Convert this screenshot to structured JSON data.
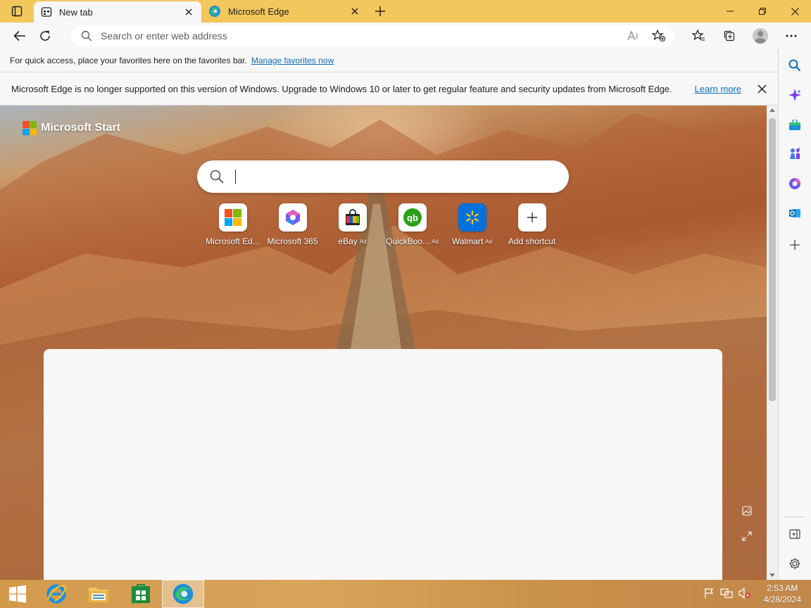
{
  "tabs": [
    {
      "title": "New tab",
      "active": true,
      "icon": "newtab-page-icon"
    },
    {
      "title": "Microsoft Edge",
      "active": false,
      "icon": "edge-logo-icon"
    }
  ],
  "toolbar": {
    "address_placeholder": "Search or enter web address"
  },
  "favorites_bar": {
    "message": "For quick access, place your favorites here on the favorites bar.",
    "link": "Manage favorites now"
  },
  "infobar": {
    "message": "Microsoft Edge is no longer supported on this version of Windows. Upgrade to Windows 10 or later to get regular feature and security updates from Microsoft Edge.",
    "link": "Learn more"
  },
  "newtab": {
    "brand": "Microsoft Start",
    "shortcuts": [
      {
        "label": "Microsoft Ed...",
        "ad": "",
        "icon": "microsoft-logo-icon"
      },
      {
        "label": "Microsoft 365",
        "ad": "",
        "icon": "microsoft-365-icon"
      },
      {
        "label": "eBay",
        "ad": "Ad",
        "icon": "ebay-bag-icon"
      },
      {
        "label": "QuickBoo...",
        "ad": "Ad",
        "icon": "quickbooks-icon"
      },
      {
        "label": "Walmart",
        "ad": "Ad",
        "icon": "walmart-spark-icon"
      },
      {
        "label": "Add shortcut",
        "ad": "",
        "icon": "plus-icon"
      }
    ]
  },
  "taskbar": {
    "time": "2:53 AM",
    "date": "4/28/2024"
  },
  "colors": {
    "tabstrip": "#f2c75c",
    "link": "#0f6cbd",
    "copilot": "#7a3df0"
  }
}
